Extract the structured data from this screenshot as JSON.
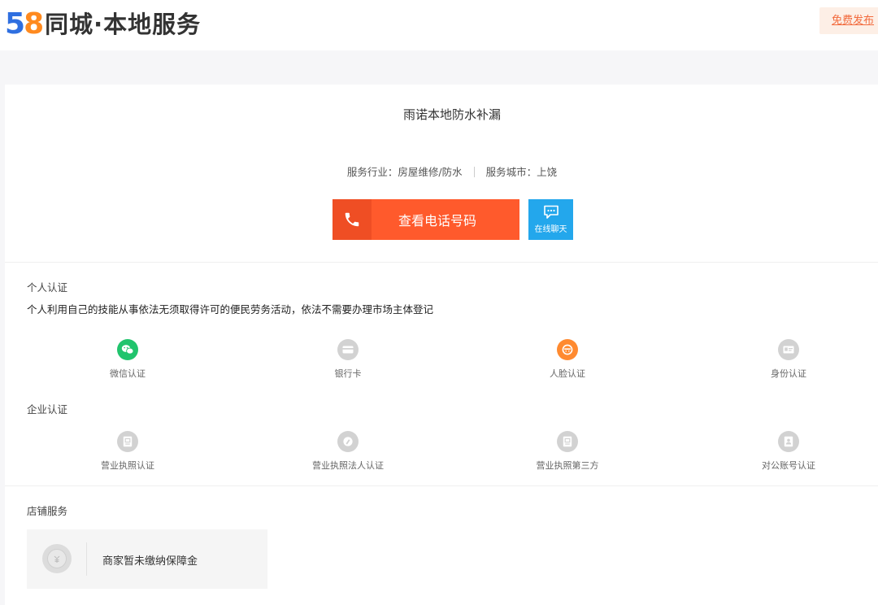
{
  "header": {
    "logo_number_5": "5",
    "logo_number_8": "8",
    "logo_text": "同城·本地服务",
    "publish_label": "免费发布"
  },
  "shop": {
    "name": "雨诺本地防水补漏",
    "industry": "服务行业：房屋维修/防水",
    "city": "服务城市：上饶",
    "phone_button": "查看电话号码",
    "chat_button": "在线聊天"
  },
  "personal_cert": {
    "title": "个人认证",
    "description": "个人利用自己的技能从事依法无须取得许可的便民劳务活动，依法不需要办理市场主体登记",
    "items": [
      {
        "label": "微信认证",
        "icon": "wechat-icon",
        "color": "#21c46d"
      },
      {
        "label": "银行卡",
        "icon": "bank-card-icon",
        "color": "#d2d2d2"
      },
      {
        "label": "人脸认证",
        "icon": "face-icon",
        "color": "#ff8a30"
      },
      {
        "label": "身份认证",
        "icon": "id-card-icon",
        "color": "#d2d2d2"
      }
    ]
  },
  "enterprise_cert": {
    "title": "企业认证",
    "items": [
      {
        "label": "营业执照认证",
        "icon": "business-license-icon"
      },
      {
        "label": "营业执照法人认证",
        "icon": "legal-person-icon"
      },
      {
        "label": "营业执照第三方",
        "icon": "third-party-license-icon"
      },
      {
        "label": "对公账号认证",
        "icon": "corporate-account-icon"
      }
    ]
  },
  "store_service": {
    "title": "店铺服务",
    "guarantee_text": "商家暂未缴纳保障金"
  }
}
